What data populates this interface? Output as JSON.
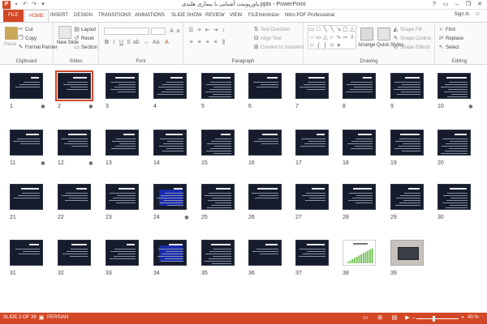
{
  "window": {
    "title": "پاورپوینت آشنایی با بیماری هلندی.pptx - PowerPoint",
    "app_icon": "P",
    "help": "?",
    "signin": "Sign in"
  },
  "tabs": [
    {
      "label": "FILE"
    },
    {
      "label": "HOME"
    },
    {
      "label": "INSERT"
    },
    {
      "label": "DESIGN"
    },
    {
      "label": "TRANSITIONS"
    },
    {
      "label": "ANIMATIONS"
    },
    {
      "label": "SLIDE SHOW"
    },
    {
      "label": "REVIEW"
    },
    {
      "label": "VIEW"
    },
    {
      "label": "FILEminimizer"
    },
    {
      "label": "Nitro PDF Professional"
    }
  ],
  "ribbon": {
    "clipboard": {
      "label": "Clipboard",
      "paste": "Paste",
      "cut": "Cut",
      "copy": "Copy",
      "format_painter": "Format Painter"
    },
    "slides": {
      "label": "Slides",
      "new_slide": "New Slide",
      "layout": "Layout",
      "reset": "Reset",
      "section": "Section"
    },
    "font": {
      "label": "Font"
    },
    "paragraph": {
      "label": "Paragraph",
      "text_direction": "Text Direction",
      "align_text": "Align Text",
      "convert_smartart": "Convert to SmartArt"
    },
    "drawing": {
      "label": "Drawing",
      "arrange": "Arrange",
      "quick_styles": "Quick Styles",
      "shape_fill": "Shape Fill",
      "shape_outline": "Shape Outline",
      "shape_effects": "Shape Effects"
    },
    "editing": {
      "label": "Editing",
      "find": "Find",
      "replace": "Replace",
      "select": "Select"
    }
  },
  "slides": [
    {
      "num": "1",
      "star": true,
      "kind": "dark"
    },
    {
      "num": "2",
      "star": true,
      "kind": "dark",
      "selected": true
    },
    {
      "num": "3",
      "star": false,
      "kind": "dark"
    },
    {
      "num": "4",
      "star": false,
      "kind": "dark"
    },
    {
      "num": "5",
      "star": false,
      "kind": "dark"
    },
    {
      "num": "6",
      "star": false,
      "kind": "dark"
    },
    {
      "num": "7",
      "star": false,
      "kind": "dark"
    },
    {
      "num": "8",
      "star": false,
      "kind": "dark"
    },
    {
      "num": "9",
      "star": false,
      "kind": "dark"
    },
    {
      "num": "10",
      "star": true,
      "kind": "dark"
    },
    {
      "num": "11",
      "star": true,
      "kind": "dark"
    },
    {
      "num": "12",
      "star": true,
      "kind": "dark"
    },
    {
      "num": "13",
      "star": false,
      "kind": "dark"
    },
    {
      "num": "14",
      "star": false,
      "kind": "dark"
    },
    {
      "num": "15",
      "star": false,
      "kind": "dark"
    },
    {
      "num": "16",
      "star": false,
      "kind": "dark"
    },
    {
      "num": "17",
      "star": false,
      "kind": "dark"
    },
    {
      "num": "18",
      "star": false,
      "kind": "dark"
    },
    {
      "num": "19",
      "star": false,
      "kind": "dark"
    },
    {
      "num": "20",
      "star": false,
      "kind": "dark"
    },
    {
      "num": "21",
      "star": false,
      "kind": "dark"
    },
    {
      "num": "22",
      "star": false,
      "kind": "dark"
    },
    {
      "num": "23",
      "star": false,
      "kind": "dark"
    },
    {
      "num": "24",
      "star": true,
      "kind": "blue"
    },
    {
      "num": "25",
      "star": false,
      "kind": "dark"
    },
    {
      "num": "26",
      "star": false,
      "kind": "dark"
    },
    {
      "num": "27",
      "star": false,
      "kind": "dark"
    },
    {
      "num": "28",
      "star": false,
      "kind": "dark"
    },
    {
      "num": "29",
      "star": false,
      "kind": "dark"
    },
    {
      "num": "30",
      "star": false,
      "kind": "dark"
    },
    {
      "num": "31",
      "star": false,
      "kind": "dark"
    },
    {
      "num": "32",
      "star": false,
      "kind": "dark"
    },
    {
      "num": "33",
      "star": false,
      "kind": "dark"
    },
    {
      "num": "34",
      "star": false,
      "kind": "blue"
    },
    {
      "num": "35",
      "star": false,
      "kind": "dark"
    },
    {
      "num": "36",
      "star": false,
      "kind": "dark"
    },
    {
      "num": "37",
      "star": false,
      "kind": "dark"
    },
    {
      "num": "38",
      "star": false,
      "kind": "chart"
    },
    {
      "num": "39",
      "star": false,
      "kind": "photo"
    }
  ],
  "star_glyph": "✱",
  "status": {
    "slide_info": "SLIDE 2 OF 39",
    "language": "PERSIAN",
    "zoom": "40 %"
  },
  "colors": {
    "accent": "#d24726",
    "slide_bg": "#161c2b",
    "selection": "#d24726"
  }
}
